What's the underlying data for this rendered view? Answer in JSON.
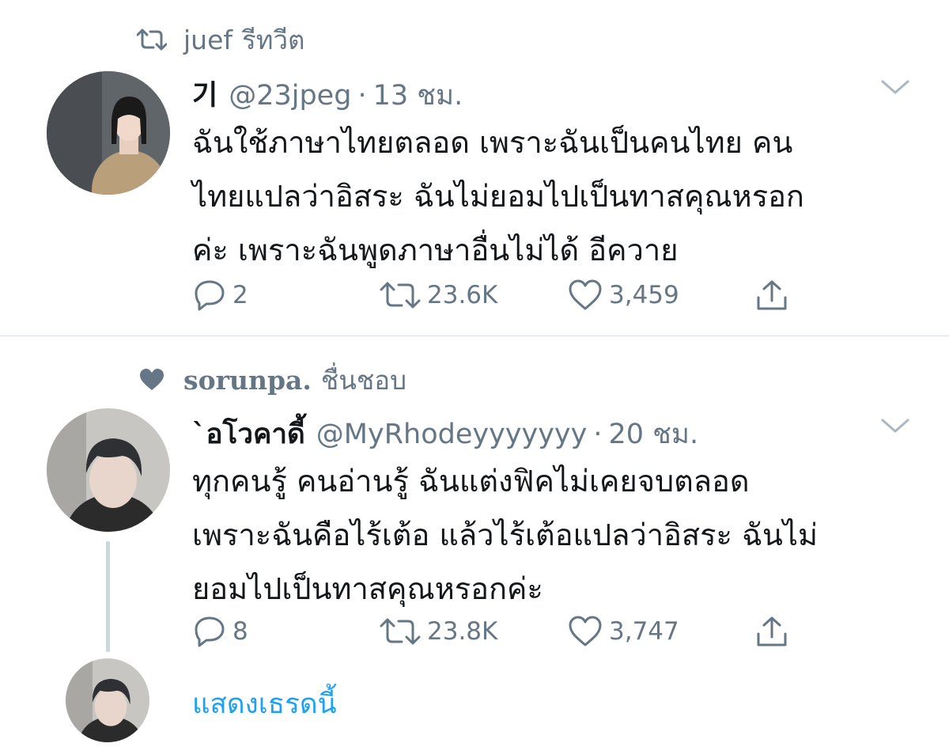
{
  "tweet1": {
    "context_user": "juef",
    "context_action": "รีทวีต",
    "display_name": "기",
    "handle": "@23jpeg",
    "time": "13 ชม.",
    "text_lines": [
      "ฉันใช้ภาษาไทยตลอด เพราะฉันเป็นคนไทย คน",
      "ไทยแปลว่าอิสระ ฉันไม่ยอมไปเป็นทาสคุณหรอก",
      "ค่ะ เพราะฉันพูดภาษาอื่นไม่ได้ อีควาย"
    ],
    "replies": "2",
    "retweets": "23.6K",
    "likes": "3,459"
  },
  "tweet2": {
    "context_user": "sorunpa.",
    "context_action": "ชื่นชอบ",
    "display_name": "`อโวคาดี้",
    "handle": "@MyRhodeyyyyyyy",
    "time": "20 ชม.",
    "text_lines": [
      "ทุกคนรู้ คนอ่านรู้ ฉันแต่งฟิคไม่เคยจบตลอด",
      "เพราะฉันคือไร้เต้อ แล้วไร้เต้อแปลว่าอิสระ ฉันไม่",
      "ยอมไปเป็นทาสคุณหรอกค่ะ"
    ],
    "replies": "8",
    "retweets": "23.8K",
    "likes": "3,747"
  },
  "show_thread": "แสดงเธรดนี้",
  "colors": {
    "link": "#1da1f2",
    "secondary": "#657786",
    "text": "#14171a"
  }
}
